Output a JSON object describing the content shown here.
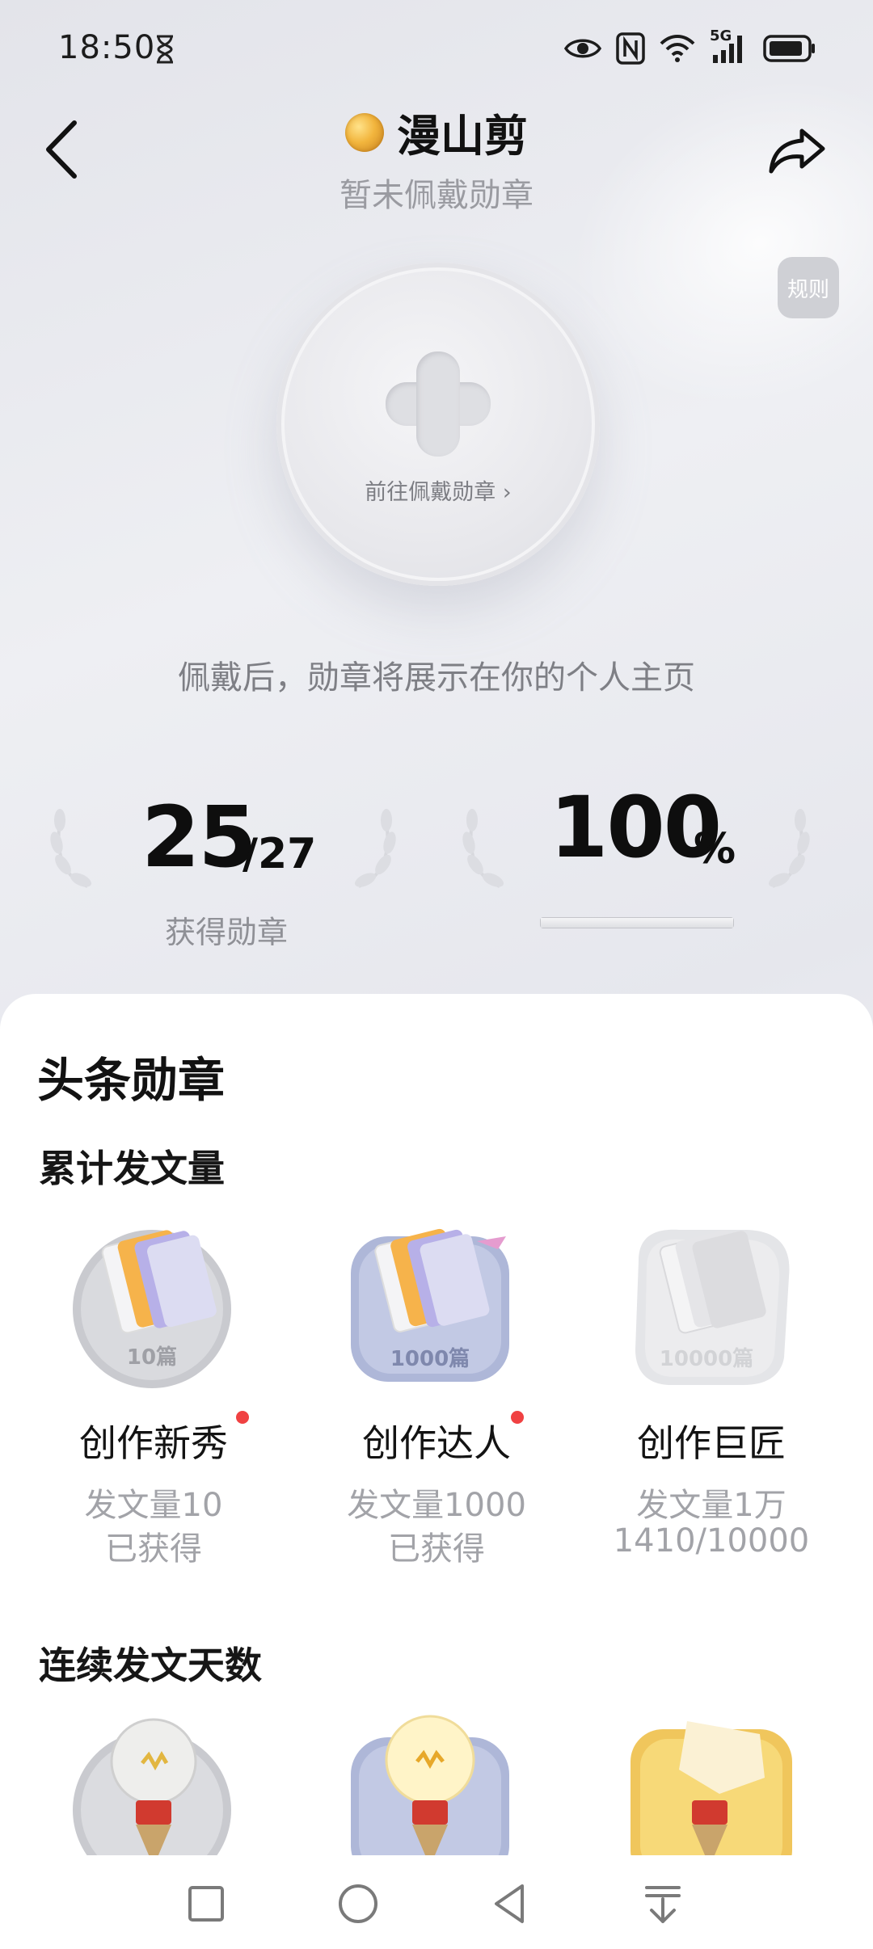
{
  "status_bar": {
    "time": "18:50",
    "network": "5G",
    "icons": [
      "hourglass-icon",
      "eye-icon",
      "nfc-icon",
      "wifi-icon",
      "signal-icon",
      "battery-icon"
    ]
  },
  "header": {
    "title": "漫山剪",
    "subtitle": "暂未佩戴勋章",
    "rules_label": "规则",
    "back_icon": "chevron-left-icon",
    "share_icon": "share-icon"
  },
  "medal": {
    "action_label": "前往佩戴勋章 ›",
    "hint": "佩戴后，勋章将展示在你的个人主页"
  },
  "stats": {
    "earned": "25",
    "total": "/27",
    "earned_label": "获得勋章",
    "percent": "100",
    "percent_sign": "%",
    "progress_fraction": 1.0
  },
  "sheet": {
    "title": "头条勋章",
    "sections": [
      {
        "title": "累计发文量",
        "badges": [
          {
            "name": "创作新秀",
            "desc": "发文量10",
            "status": "已获得",
            "label": "10篇",
            "new": true
          },
          {
            "name": "创作达人",
            "desc": "发文量1000",
            "status": "已获得",
            "label": "1000篇",
            "new": true
          },
          {
            "name": "创作巨匠",
            "desc": "发文量1万",
            "status": "1410/10000",
            "label": "10000篇",
            "new": false
          }
        ]
      },
      {
        "title": "连续发文天数",
        "badges": [
          {
            "name": "",
            "desc": "",
            "status": "",
            "label": "",
            "new": false
          },
          {
            "name": "",
            "desc": "",
            "status": "",
            "label": "",
            "new": false
          },
          {
            "name": "",
            "desc": "",
            "status": "",
            "label": "",
            "new": false
          }
        ]
      }
    ]
  },
  "colors": {
    "accent_red": "#f04142",
    "text_primary": "#111111",
    "text_secondary": "#9a9ba1",
    "silver_badge": "#c9cacf",
    "blue_badge": "#aeb7d8",
    "gold_badge": "#f0c65c"
  },
  "nav_bar": {
    "icons": [
      "square-icon",
      "circle-icon",
      "triangle-back-icon",
      "download-arrow-icon"
    ]
  }
}
